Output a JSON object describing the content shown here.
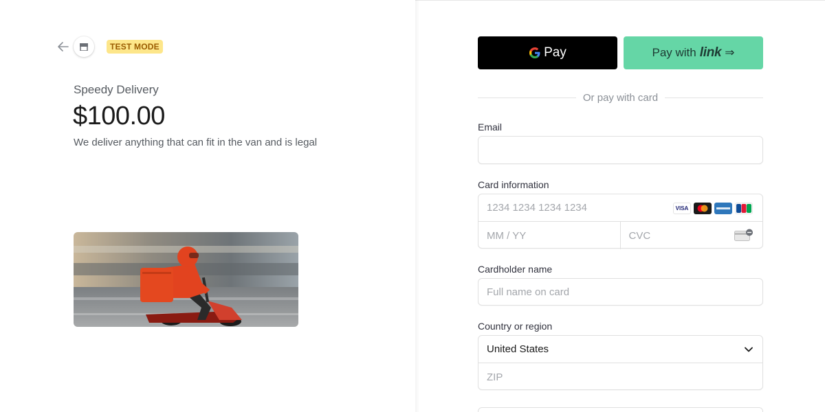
{
  "header": {
    "test_mode_label": "TEST MODE"
  },
  "product": {
    "merchant_name": "Speedy Delivery",
    "price": "$100.00",
    "description": "We deliver anything that can fit in the van and is legal",
    "image_icon": "delivery-rider-photo"
  },
  "wallets": {
    "gpay_label": "Pay",
    "link_prefix": "Pay with",
    "link_word": "link",
    "link_arrow": "⇒"
  },
  "divider_text": "Or pay with card",
  "form": {
    "email_label": "Email",
    "email_value": "",
    "card_label": "Card information",
    "card_number_placeholder": "1234 1234 1234 1234",
    "expiry_placeholder": "MM / YY",
    "cvc_placeholder": "CVC",
    "card_brands": [
      "VISA",
      "mastercard",
      "amex",
      "JCB"
    ],
    "cardholder_label": "Cardholder name",
    "cardholder_placeholder": "Full name on card",
    "country_label": "Country or region",
    "country_value": "United States",
    "zip_placeholder": "ZIP"
  },
  "colors": {
    "link_green": "#65d6a6",
    "test_badge_bg": "#fde68a",
    "gpay_black": "#000000"
  }
}
